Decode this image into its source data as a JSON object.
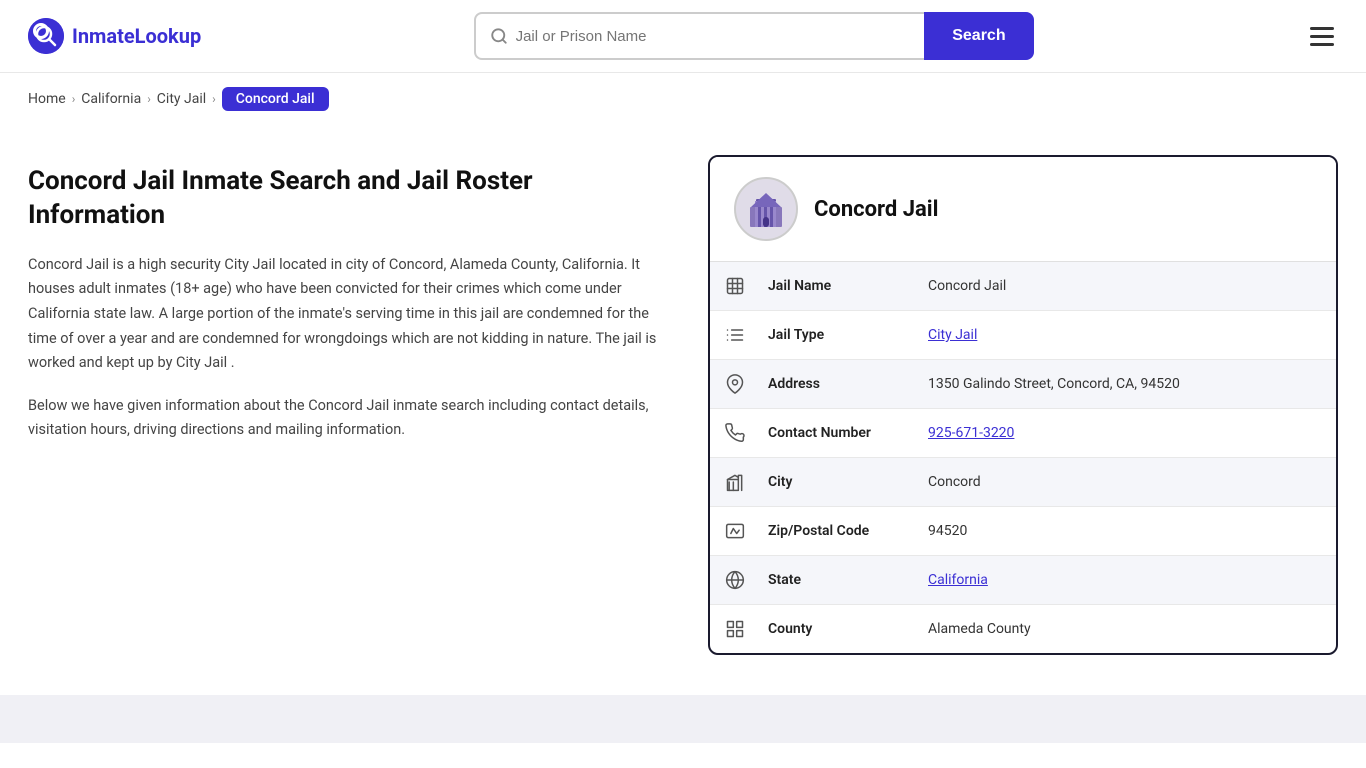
{
  "header": {
    "logo_text": "InmateLookup",
    "search_placeholder": "Jail or Prison Name",
    "search_button_label": "Search"
  },
  "breadcrumb": {
    "items": [
      {
        "label": "Home",
        "href": "#"
      },
      {
        "label": "California",
        "href": "#"
      },
      {
        "label": "City Jail",
        "href": "#"
      },
      {
        "label": "Concord Jail",
        "active": true
      }
    ]
  },
  "left": {
    "page_title": "Concord Jail Inmate Search and Jail Roster Information",
    "description1": "Concord Jail is a high security City Jail located in city of Concord, Alameda County, California. It houses adult inmates (18+ age) who have been convicted for their crimes which come under California state law. A large portion of the inmate's serving time in this jail are condemned for the time of over a year and are condemned for wrongdoings which are not kidding in nature. The jail is worked and kept up by City Jail .",
    "description2": "Below we have given information about the Concord Jail inmate search including contact details, visitation hours, driving directions and mailing information."
  },
  "jail_card": {
    "name": "Concord Jail",
    "fields": [
      {
        "icon": "building",
        "label": "Jail Name",
        "value": "Concord Jail",
        "link": false,
        "shaded": true
      },
      {
        "icon": "list",
        "label": "Jail Type",
        "value": "City Jail",
        "link": true,
        "shaded": false
      },
      {
        "icon": "location",
        "label": "Address",
        "value": "1350 Galindo Street, Concord, CA, 94520",
        "link": false,
        "shaded": true
      },
      {
        "icon": "phone",
        "label": "Contact Number",
        "value": "925-671-3220",
        "link": true,
        "shaded": false
      },
      {
        "icon": "city",
        "label": "City",
        "value": "Concord",
        "link": false,
        "shaded": true
      },
      {
        "icon": "zip",
        "label": "Zip/Postal Code",
        "value": "94520",
        "link": false,
        "shaded": false
      },
      {
        "icon": "state",
        "label": "State",
        "value": "California",
        "link": true,
        "shaded": true
      },
      {
        "icon": "county",
        "label": "County",
        "value": "Alameda County",
        "link": false,
        "shaded": false
      }
    ]
  },
  "colors": {
    "accent": "#3b2fd4",
    "link": "#3b2fd4"
  }
}
